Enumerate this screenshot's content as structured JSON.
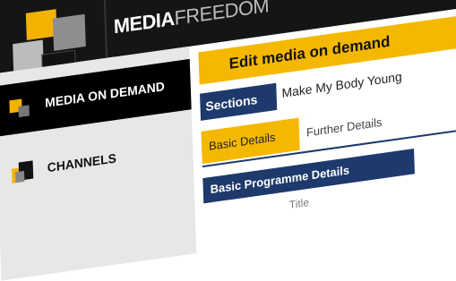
{
  "brand": {
    "part1": "MEDIA",
    "part2": "FREEDOM"
  },
  "sidebar": {
    "items": [
      {
        "label": "MEDIA ON DEMAND",
        "active": true
      },
      {
        "label": "CHANNELS",
        "active": false
      }
    ]
  },
  "content": {
    "title": "Edit media on demand",
    "sections_label": "Sections",
    "sections_value": "Make My Body Young",
    "tabs": [
      {
        "label": "Basic Details",
        "active": true
      },
      {
        "label": "Further Details",
        "active": false
      }
    ],
    "panel_title": "Basic Programme Details",
    "field_label": "Title"
  },
  "colors": {
    "accent_yellow": "#f4b800",
    "navy": "#1e3a6d",
    "header_black": "#151515",
    "sidebar_gray": "#e7e7e7"
  }
}
